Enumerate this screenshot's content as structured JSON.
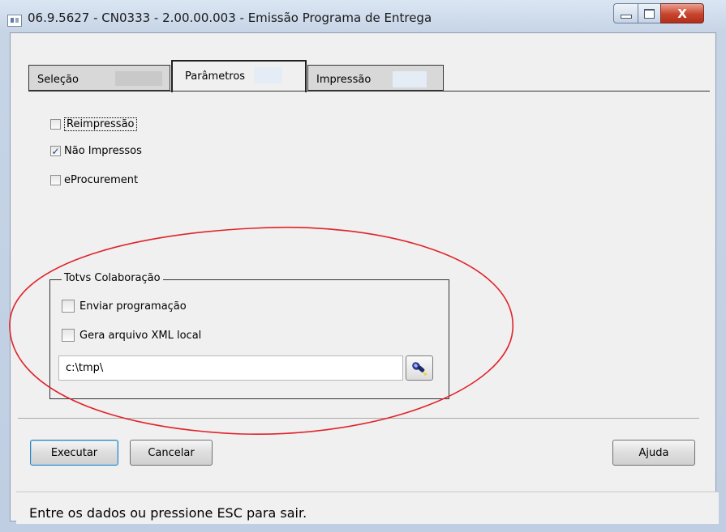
{
  "window": {
    "title": "06.9.5627 - CN0333 - 2.00.00.003 - Emissão Programa de Entrega",
    "close_glyph": "X"
  },
  "tabs": [
    {
      "label": "Seleção",
      "selected": false
    },
    {
      "label": "Parâmetros",
      "selected": true
    },
    {
      "label": "Impressão",
      "selected": false
    }
  ],
  "options": {
    "reimpressao": {
      "label": "Reimpressão",
      "checked": false
    },
    "nao_impressos": {
      "label": "Não Impressos",
      "checked": true
    },
    "eprocurement": {
      "label": "eProcurement",
      "checked": false
    }
  },
  "totvs": {
    "title": "Totvs Colaboração",
    "enviar": {
      "label": "Enviar programação",
      "checked": false
    },
    "gera_xml": {
      "label": "Gera arquivo XML local",
      "checked": false
    },
    "path_value": "c:\\tmp\\"
  },
  "buttons": {
    "executar": "Executar",
    "cancelar": "Cancelar",
    "ajuda": "Ajuda"
  },
  "status": {
    "message": "Entre os dados ou pressione ESC para sair."
  },
  "colors": {
    "annotation": "#e0232a",
    "checkmark": "#1e3a78"
  },
  "icons": {
    "browse": "flashlight-icon"
  }
}
